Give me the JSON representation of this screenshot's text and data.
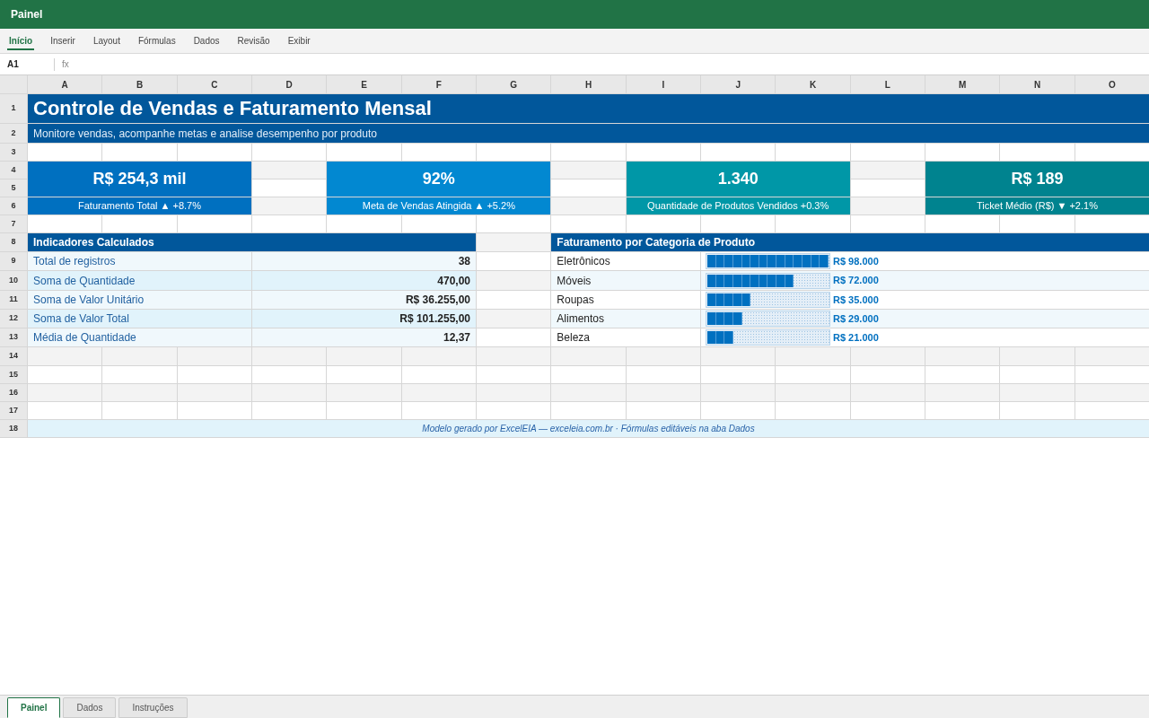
{
  "title_bar": {
    "title": "Painel"
  },
  "ribbon_tabs": [
    {
      "label": "Início",
      "selected": true
    },
    {
      "label": "Inserir",
      "selected": false
    },
    {
      "label": "Layout",
      "selected": false
    },
    {
      "label": "Fórmulas",
      "selected": false
    },
    {
      "label": "Dados",
      "selected": false
    },
    {
      "label": "Revisão",
      "selected": false
    },
    {
      "label": "Exibir",
      "selected": false
    }
  ],
  "formula_bar": {
    "cell_reference": "A1",
    "function_label": "fx"
  },
  "sheet": {
    "columns": [
      "A",
      "B",
      "C",
      "D",
      "E",
      "F",
      "G",
      "H",
      "I",
      "J",
      "K",
      "L",
      "M",
      "N",
      "O"
    ],
    "rows": [
      "1",
      "2",
      "3",
      "4",
      "5",
      "6",
      "7",
      "8",
      "9",
      "10",
      "11",
      "12",
      "13",
      "14",
      "15",
      "16",
      "17",
      "18"
    ],
    "title": "Controle de Vendas e Faturamento Mensal",
    "subtitle": "Monitore vendas, acompanhe metas e analise desempenho por produto",
    "kpis": [
      {
        "value": "R$ 254,3 mil",
        "label": "Faturamento Total ▲ +8.7%",
        "color": "#0070c0"
      },
      {
        "value": "92%",
        "label": "Meta de Vendas Atingida ▲ +5.2%",
        "color": "#0288d1"
      },
      {
        "value": "1.340",
        "label": "Quantidade de Produtos Vendidos +0.3%",
        "color": "#0097a7"
      },
      {
        "value": "R$ 189",
        "label": "Ticket Médio (R$) ▼ +2.1%",
        "color": "#00838f"
      }
    ],
    "indicators": {
      "header": "Indicadores Calculados",
      "rows": [
        {
          "label": "Total de registros",
          "value": "38"
        },
        {
          "label": "Soma de Quantidade",
          "value": "470,00"
        },
        {
          "label": "Soma de Valor Unitário",
          "value": "R$ 36.255,00"
        },
        {
          "label": "Soma de Valor Total",
          "value": "R$ 101.255,00"
        },
        {
          "label": "Média de Quantidade",
          "value": "12,37"
        }
      ]
    },
    "revenue_by_category": {
      "header": "Faturamento por Categoria de Produto",
      "rows": [
        {
          "category": "Eletrônicos",
          "level": 1,
          "value": "R$ 98.000"
        },
        {
          "category": "Móveis",
          "level": 0.714,
          "value": "R$ 72.000"
        },
        {
          "category": "Roupas",
          "level": 0.357,
          "value": "R$ 35.000"
        },
        {
          "category": "Alimentos",
          "level": 0.286,
          "value": "R$ 29.000"
        },
        {
          "category": "Beleza",
          "level": 0.214,
          "value": "R$ 21.000"
        }
      ]
    },
    "footer_note": "Modelo gerado por ExcelEIA — exceleia.com.br · Fórmulas editáveis na aba Dados"
  },
  "sheet_tabs": [
    {
      "label": "Painel",
      "selected": true
    },
    {
      "label": "Dados",
      "selected": false
    },
    {
      "label": "Instruções",
      "selected": false
    }
  ]
}
